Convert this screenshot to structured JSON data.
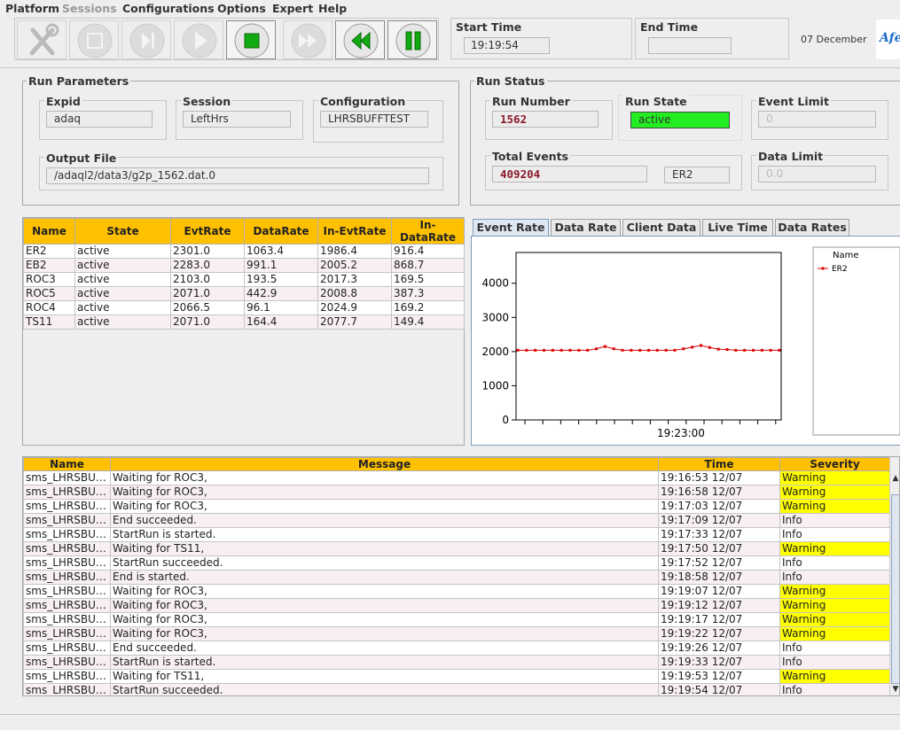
{
  "menu": {
    "platform": "Platform",
    "sessions": "Sessions",
    "configurations": "Configurations",
    "options": "Options",
    "expert": "Expert",
    "help": "Help"
  },
  "time": {
    "start_label": "Start Time",
    "start_value": "19:19:54",
    "end_label": "End Time",
    "end_value": "",
    "date": "07 December",
    "logo_text": "Afe"
  },
  "run_parameters": {
    "title": "Run Parameters",
    "expid_label": "Expid",
    "expid": "adaq",
    "session_label": "Session",
    "session": "LeftHrs",
    "configuration_label": "Configuration",
    "configuration": "LHRSBUFFTEST",
    "output_file_label": "Output File",
    "output_file": "/adaql2/data3/g2p_1562.dat.0"
  },
  "run_status": {
    "title": "Run Status",
    "run_number_label": "Run Number",
    "run_number": "1562",
    "run_state_label": "Run State",
    "run_state": "active",
    "event_limit_label": "Event Limit",
    "event_limit": "0",
    "total_events_label": "Total Events",
    "total_events": "409204",
    "total_events_component": "ER2",
    "data_limit_label": "Data Limit",
    "data_limit": "0.0",
    "colors": {
      "active": "#22ee22"
    }
  },
  "components_table": {
    "headers": [
      "Name",
      "State",
      "EvtRate",
      "DataRate",
      "In-EvtRate",
      "In-DataRate"
    ],
    "rows": [
      [
        "ER2",
        "active",
        "2301.0",
        "1063.4",
        "1986.4",
        "916.4"
      ],
      [
        "EB2",
        "active",
        "2283.0",
        "991.1",
        "2005.2",
        "868.7"
      ],
      [
        "ROC3",
        "active",
        "2103.0",
        "193.5",
        "2017.3",
        "169.5"
      ],
      [
        "ROC5",
        "active",
        "2071.0",
        "442.9",
        "2008.8",
        "387.3"
      ],
      [
        "ROC4",
        "active",
        "2066.5",
        "96.1",
        "2024.9",
        "169.2"
      ],
      [
        "TS11",
        "active",
        "2071.0",
        "164.4",
        "2077.7",
        "149.4"
      ]
    ]
  },
  "tabs": [
    "Event Rate",
    "Data Rate",
    "Client Data",
    "Live Time",
    "Data Rates"
  ],
  "chart_data": {
    "type": "line",
    "x_tick_label": "19:23:00",
    "y_ticks": [
      0,
      1000,
      2000,
      3000,
      4000
    ],
    "ylim": [
      0,
      4900
    ],
    "legend_title": "Name",
    "series": [
      {
        "name": "ER2",
        "color": "#dd0000",
        "values": [
          2040,
          2040,
          2040,
          2040,
          2040,
          2040,
          2040,
          2040,
          2040,
          2080,
          2150,
          2080,
          2040,
          2040,
          2040,
          2040,
          2040,
          2040,
          2040,
          2080,
          2130,
          2180,
          2120,
          2070,
          2060,
          2040,
          2040,
          2040,
          2040,
          2040,
          2040
        ]
      }
    ]
  },
  "messages_table": {
    "headers": [
      "Name",
      "Message",
      "Time",
      "Severity"
    ],
    "rows": [
      [
        "sms_LHRSBUF...",
        "Waiting for ROC3,",
        "19:16:53 12/07",
        "Warning"
      ],
      [
        "sms_LHRSBUF...",
        "Waiting for ROC3,",
        "19:16:58 12/07",
        "Warning"
      ],
      [
        "sms_LHRSBUF...",
        "Waiting for ROC3,",
        "19:17:03 12/07",
        "Warning"
      ],
      [
        "sms_LHRSBUF...",
        "End succeeded.",
        "19:17:09 12/07",
        "Info"
      ],
      [
        "sms_LHRSBUF...",
        "StartRun is started.",
        "19:17:33 12/07",
        "Info"
      ],
      [
        "sms_LHRSBUF...",
        "Waiting for TS11,",
        "19:17:50 12/07",
        "Warning"
      ],
      [
        "sms_LHRSBUF...",
        "StartRun succeeded.",
        "19:17:52 12/07",
        "Info"
      ],
      [
        "sms_LHRSBUF...",
        "End is started.",
        "19:18:58 12/07",
        "Info"
      ],
      [
        "sms_LHRSBUF...",
        "Waiting for ROC3,",
        "19:19:07 12/07",
        "Warning"
      ],
      [
        "sms_LHRSBUF...",
        "Waiting for ROC3,",
        "19:19:12 12/07",
        "Warning"
      ],
      [
        "sms_LHRSBUF...",
        "Waiting for ROC3,",
        "19:19:17 12/07",
        "Warning"
      ],
      [
        "sms_LHRSBUF...",
        "Waiting for ROC3,",
        "19:19:22 12/07",
        "Warning"
      ],
      [
        "sms_LHRSBUF...",
        "End succeeded.",
        "19:19:26 12/07",
        "Info"
      ],
      [
        "sms_LHRSBUF...",
        "StartRun is started.",
        "19:19:33 12/07",
        "Info"
      ],
      [
        "sms_LHRSBUF...",
        "Waiting for TS11,",
        "19:19:53 12/07",
        "Warning"
      ],
      [
        "sms_LHRSBUF...",
        "StartRun succeeded.",
        "19:19:54 12/07",
        "Info"
      ]
    ],
    "colors": {
      "header": "#ffc000",
      "warning": "#ffff00"
    }
  }
}
